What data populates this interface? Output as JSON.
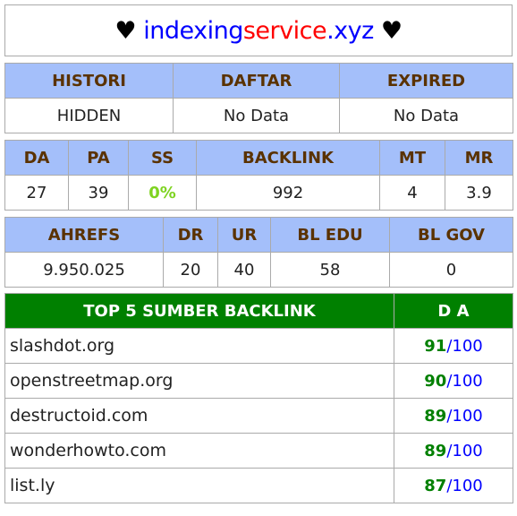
{
  "title": {
    "heart": "♥",
    "part1": "indexing",
    "part2": "service",
    "part3": ".xyz"
  },
  "table1": {
    "headers": [
      "HISTORI",
      "DAFTAR",
      "EXPIRED"
    ],
    "values": [
      "HIDDEN",
      "No Data",
      "No Data"
    ]
  },
  "table2": {
    "headers": [
      "DA",
      "PA",
      "SS",
      "BACKLINK",
      "MT",
      "MR"
    ],
    "values": [
      "27",
      "39",
      "0%",
      "992",
      "4",
      "3.9"
    ]
  },
  "table3": {
    "headers": [
      "AHREFS",
      "DR",
      "UR",
      "BL EDU",
      "BL GOV"
    ],
    "values": [
      "9.950.025",
      "20",
      "40",
      "58",
      "0"
    ]
  },
  "table4": {
    "headers": [
      "TOP 5 SUMBER BACKLINK",
      "D A"
    ],
    "max": "100",
    "rows": [
      {
        "domain": "slashdot.org",
        "da": "91"
      },
      {
        "domain": "openstreetmap.org",
        "da": "90"
      },
      {
        "domain": "destructoid.com",
        "da": "89"
      },
      {
        "domain": "wonderhowto.com",
        "da": "89"
      },
      {
        "domain": "list.ly",
        "da": "87"
      }
    ]
  },
  "colors": {
    "header_bg": "#a4bffa",
    "header_text": "#5a3200",
    "top5_bg": "#008000",
    "ss": "#7ed321"
  }
}
